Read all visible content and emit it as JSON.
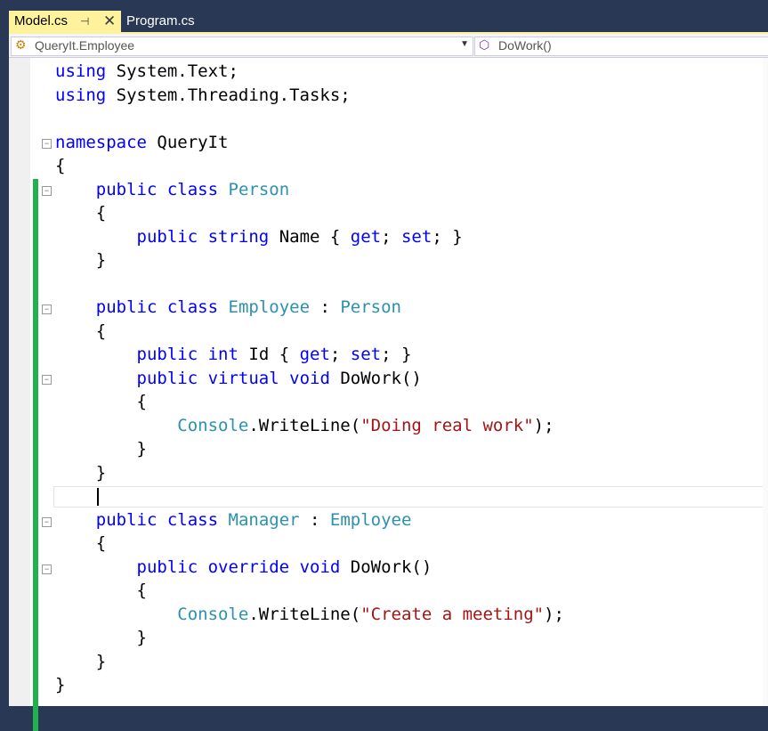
{
  "tabs": [
    {
      "label": "Model.cs",
      "active": true,
      "pinned_icon": "pin-icon",
      "close_icon": "close-icon"
    },
    {
      "label": "Program.cs",
      "active": false
    }
  ],
  "nav": {
    "type_combo": {
      "icon": "class-icon",
      "value": "QueryIt.Employee"
    },
    "member_combo": {
      "icon": "method-icon",
      "value": "DoWork()"
    }
  },
  "code_lines": [
    "using System.Text;",
    "using System.Threading.Tasks;",
    "",
    "namespace QueryIt",
    "{",
    "    public class Person",
    "    {",
    "        public string Name { get; set; }",
    "    }",
    "",
    "    public class Employee : Person",
    "    {",
    "        public int Id { get; set; }",
    "        public virtual void DoWork()",
    "        {",
    "            Console.WriteLine(\"Doing real work\");",
    "        }",
    "    }",
    "",
    "    public class Manager : Employee",
    "    {",
    "        public override void DoWork()",
    "        {",
    "            Console.WriteLine(\"Create a meeting\");",
    "        }",
    "    }",
    "}"
  ],
  "colors": {
    "keyword": "#0000ff",
    "type": "#2b91af",
    "string": "#a31515",
    "active_tab": "#fff29d",
    "change_bar": "#22b14c"
  }
}
